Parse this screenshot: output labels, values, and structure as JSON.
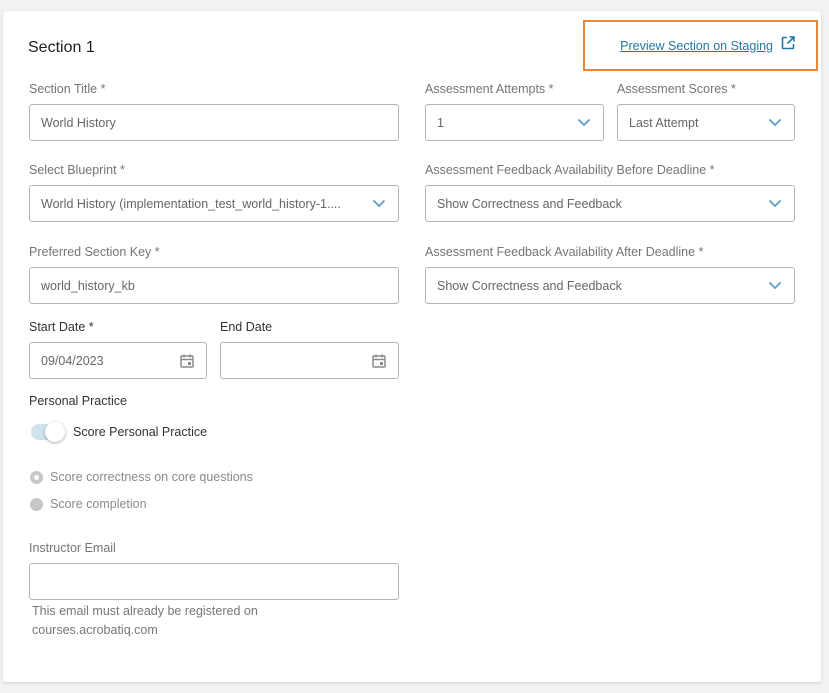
{
  "section": {
    "title": "Section 1",
    "preview_link": "Preview Section on Staging"
  },
  "fields": {
    "section_title": {
      "label": "Section Title *",
      "value": "World History"
    },
    "assessment_attempts": {
      "label": "Assessment Attempts *",
      "value": "1"
    },
    "assessment_scores": {
      "label": "Assessment Scores *",
      "value": "Last Attempt"
    },
    "blueprint": {
      "label": "Select Blueprint *",
      "value": "World History (implementation_test_world_history-1...."
    },
    "feedback_before": {
      "label": "Assessment Feedback Availability Before Deadline *",
      "value": "Show Correctness and Feedback"
    },
    "section_key": {
      "label": "Preferred Section Key *",
      "value": "world_history_kb"
    },
    "feedback_after": {
      "label": "Assessment Feedback Availability After Deadline *",
      "value": "Show Correctness and Feedback"
    },
    "start_date": {
      "label": "Start Date *",
      "value": "09/04/2023"
    },
    "end_date": {
      "label": "End Date",
      "value": ""
    },
    "instructor_email": {
      "label": "Instructor Email",
      "value": "",
      "helper": "This email must already be registered on courses.acrobatiq.com"
    }
  },
  "personal_practice": {
    "heading": "Personal Practice",
    "toggle_label": "Score Personal Practice",
    "options": [
      {
        "label": "Score correctness on core questions",
        "selected": true
      },
      {
        "label": "Score completion",
        "selected": false
      }
    ]
  },
  "colors": {
    "accent": "#1f7aa8",
    "highlight_border": "#e8873a",
    "chevron": "#5b9fc4"
  },
  "icons": {
    "chevron": "chevron-down-icon",
    "calendar": "calendar-icon",
    "external": "external-link-icon"
  }
}
